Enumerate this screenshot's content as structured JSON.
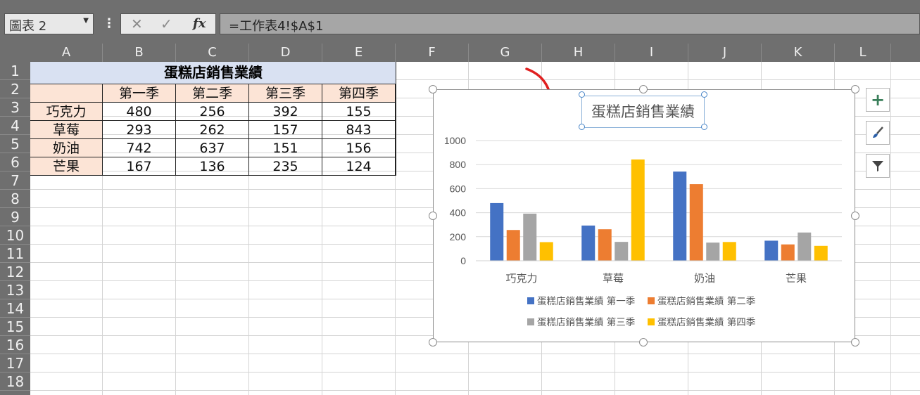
{
  "formula_bar": {
    "name_box": "圖表 2",
    "cancel_glyph": "✕",
    "enter_glyph": "✓",
    "fx_label": "fx",
    "formula": "=工作表4!$A$1"
  },
  "columns": [
    "A",
    "B",
    "C",
    "D",
    "E",
    "F",
    "G",
    "H",
    "I",
    "J",
    "K",
    "L"
  ],
  "rows": [
    "1",
    "2",
    "3",
    "4",
    "5",
    "6",
    "7",
    "8",
    "9",
    "10",
    "11",
    "12",
    "13",
    "14",
    "15",
    "16",
    "17",
    "18"
  ],
  "table": {
    "title": "蛋糕店銷售業績",
    "headers": [
      "",
      "第一季",
      "第二季",
      "第三季",
      "第四季"
    ],
    "rows": [
      [
        "巧克力",
        "480",
        "256",
        "392",
        "155"
      ],
      [
        "草莓",
        "293",
        "262",
        "157",
        "843"
      ],
      [
        "奶油",
        "742",
        "637",
        "151",
        "156"
      ],
      [
        "芒果",
        "167",
        "136",
        "235",
        "124"
      ]
    ]
  },
  "chart_tools": {
    "add_element": "+"
  },
  "colors": {
    "series1": "#4472c4",
    "series2": "#ed7d31",
    "series3": "#a5a5a5",
    "series4": "#ffc000",
    "arrow": "#e02020"
  },
  "chart_data": {
    "type": "bar",
    "title": "蛋糕店銷售業績",
    "categories": [
      "巧克力",
      "草莓",
      "奶油",
      "芒果"
    ],
    "ylim": [
      0,
      1000
    ],
    "yticks": [
      0,
      200,
      400,
      600,
      800,
      1000
    ],
    "grid": true,
    "legend_position": "bottom",
    "series": [
      {
        "name": "蛋糕店銷售業績 第一季",
        "values": [
          480,
          293,
          742,
          167
        ]
      },
      {
        "name": "蛋糕店銷售業績 第二季",
        "values": [
          256,
          262,
          637,
          136
        ]
      },
      {
        "name": "蛋糕店銷售業績 第三季",
        "values": [
          392,
          157,
          151,
          235
        ]
      },
      {
        "name": "蛋糕店銷售業績 第四季",
        "values": [
          155,
          843,
          156,
          124
        ]
      }
    ]
  }
}
